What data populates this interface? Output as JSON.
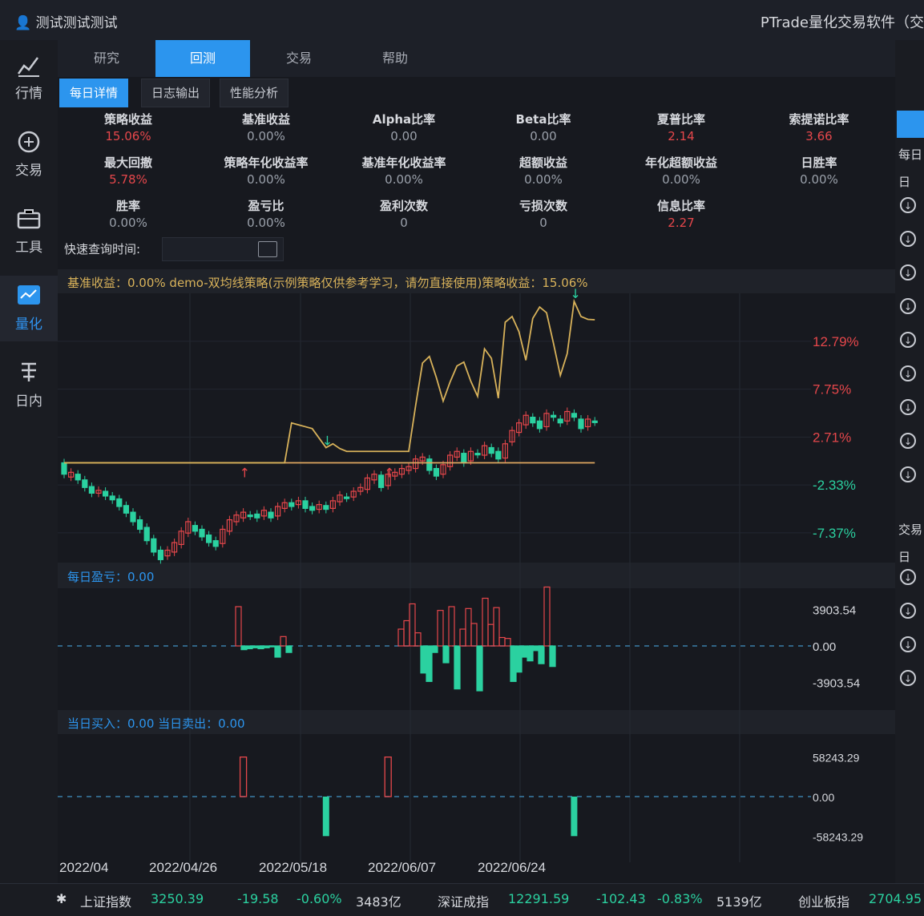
{
  "titlebar": {
    "user": "测试测试测试",
    "app": "PTrade量化交易软件（交"
  },
  "nav": [
    {
      "label": "行情",
      "icon": "chart-icon"
    },
    {
      "label": "交易",
      "icon": "trade-icon"
    },
    {
      "label": "工具",
      "icon": "toolbox-icon"
    },
    {
      "label": "量化",
      "icon": "quant-icon"
    },
    {
      "label": "日内",
      "icon": "intraday-icon"
    }
  ],
  "tabs": [
    "研究",
    "回测",
    "交易",
    "帮助"
  ],
  "subtabs": [
    "每日详情",
    "日志输出",
    "性能分析"
  ],
  "metrics": [
    {
      "label": "策略收益",
      "value": "15.06%",
      "color": "red"
    },
    {
      "label": "基准收益",
      "value": "0.00%",
      "color": ""
    },
    {
      "label": "Alpha比率",
      "value": "0.00",
      "color": ""
    },
    {
      "label": "Beta比率",
      "value": "0.00",
      "color": ""
    },
    {
      "label": "夏普比率",
      "value": "2.14",
      "color": "red"
    },
    {
      "label": "索提诺比率",
      "value": "3.66",
      "color": "red"
    },
    {
      "label": "最大回撤",
      "value": "5.78%",
      "color": "red"
    },
    {
      "label": "策略年化收益率",
      "value": "0.00%",
      "color": ""
    },
    {
      "label": "基准年化收益率",
      "value": "0.00%",
      "color": ""
    },
    {
      "label": "超额收益",
      "value": "0.00%",
      "color": ""
    },
    {
      "label": "年化超额收益",
      "value": "0.00%",
      "color": ""
    },
    {
      "label": "日胜率",
      "value": "0.00%",
      "color": ""
    },
    {
      "label": "胜率",
      "value": "0.00%",
      "color": ""
    },
    {
      "label": "盈亏比",
      "value": "0.00%",
      "color": ""
    },
    {
      "label": "盈利次数",
      "value": "0",
      "color": ""
    },
    {
      "label": "亏损次数",
      "value": "0",
      "color": ""
    },
    {
      "label": "信息比率",
      "value": "2.27",
      "color": "red"
    }
  ],
  "quick_query": {
    "label": "快速查询时间:"
  },
  "legends": {
    "main": "基准收益：0.00% demo-双均线策略(示例策略仅供参考学习，请勿直接使用)策略收益：15.06%",
    "daily_pnl": "每日盈亏：0.00",
    "trades": "当日买入：0.00  当日卖出：0.00"
  },
  "right_panel": {
    "labels": [
      "每日",
      "日",
      "交易",
      "日"
    ]
  },
  "status": {
    "sh_name": "上证指数",
    "sh_price": "3250.39",
    "sh_chg": "-19.58",
    "sh_pct": "-0.60%",
    "sh_vol": "3483亿",
    "sz_name": "深证成指",
    "sz_price": "12291.59",
    "sz_chg": "-102.43",
    "sz_pct": "-0.83%",
    "sz_vol": "5139亿",
    "cy_name": "创业板指",
    "cy_price": "2704.95"
  },
  "colors": {
    "up": "#e6474b",
    "down": "#2bd1a0",
    "strategy": "#d8b25a",
    "accent": "#2c95ee"
  },
  "chart_data": [
    {
      "type": "line",
      "title": "",
      "x_ticks": [
        "2022/04",
        "2022/04/26",
        "2022/05/18",
        "2022/06/07",
        "2022/06/24"
      ],
      "y_ticks": [
        "12.79%",
        "7.75%",
        "2.71%",
        "-2.33%",
        "-7.37%"
      ],
      "ylim": [
        -10,
        17
      ],
      "series": [
        {
          "name": "基准收益",
          "values": [
            0.0,
            0.0,
            0.0,
            0.0,
            0.0,
            0.0,
            0.0,
            0.0,
            0.0,
            0.0,
            0.0,
            0.0,
            0.0,
            0.0,
            0.0,
            0.0,
            0.0,
            0.0,
            0.0,
            0.0,
            0.0,
            0.0,
            0.0,
            0.0,
            0.0,
            0.0,
            0.0,
            0.0,
            0.0,
            0.0,
            0.0,
            0.0,
            0.0,
            0.0,
            0.0,
            0.0,
            0.0,
            0.0,
            0.0,
            0.0,
            0.0,
            0.0,
            0.0,
            0.0,
            0.0,
            0.0,
            0.0,
            0.0,
            0.0,
            0.0,
            0.0,
            0.0,
            0.0,
            0.0,
            0.0,
            0.0,
            0.0,
            0.0,
            0.0,
            0.0,
            0.0,
            0.0,
            0.0,
            0.0,
            0.0,
            0.0,
            0.0,
            0.0,
            0.0,
            0.0,
            0.0,
            0.0,
            0.0,
            0.0,
            0.0,
            0.0,
            0.0,
            0.0
          ]
        },
        {
          "name": "策略收益",
          "values": [
            0.0,
            0.0,
            0.0,
            0.0,
            0.0,
            0.0,
            0.0,
            0.0,
            0.0,
            0.0,
            0.0,
            0.0,
            0.0,
            0.0,
            0.0,
            0.0,
            0.0,
            0.0,
            0.0,
            0.0,
            0.0,
            0.0,
            0.0,
            0.0,
            0.0,
            0.0,
            0.0,
            0.0,
            0.0,
            0.0,
            0.0,
            0.0,
            0.0,
            4.2,
            4.0,
            3.8,
            3.6,
            2.6,
            1.6,
            2.0,
            1.5,
            1.2,
            1.2,
            1.2,
            1.2,
            1.2,
            1.2,
            1.2,
            1.2,
            1.2,
            1.2,
            6.0,
            10.5,
            11.2,
            9.0,
            6.5,
            8.5,
            10.2,
            10.6,
            8.6,
            7.0,
            12.0,
            11.0,
            6.8,
            14.8,
            15.4,
            13.8,
            10.8,
            15.2,
            16.4,
            15.8,
            12.6,
            9.2,
            11.5,
            17.0,
            15.4,
            15.1,
            15.06
          ]
        }
      ],
      "candles": {
        "open": [
          0,
          -1.5,
          -1.2,
          -1.8,
          -2.5,
          -3.2,
          -3.0,
          -3.5,
          -3.8,
          -4.5,
          -5.2,
          -6.0,
          -6.8,
          -8.0,
          -9.2,
          -9.8,
          -9.4,
          -8.6,
          -7.4,
          -6.6,
          -7.0,
          -7.6,
          -8.2,
          -8.5,
          -7.2,
          -6.2,
          -5.8,
          -5.5,
          -5.4,
          -5.6,
          -5.2,
          -5.6,
          -4.8,
          -4.2,
          -4.4,
          -4.0,
          -4.6,
          -4.9,
          -4.5,
          -4.8,
          -4.1,
          -3.6,
          -3.6,
          -3.0,
          -2.8,
          -1.8,
          -1.3,
          -2.4,
          -1.4,
          -1.2,
          -0.8,
          -0.6,
          0.2,
          0.4,
          -0.6,
          -1.2,
          -0.4,
          0.6,
          1.0,
          0.2,
          1.0,
          0.8,
          1.6,
          1.2,
          0.5,
          2.2,
          3.2,
          4.0,
          4.8,
          4.4,
          3.8,
          5.0,
          4.6,
          4.4,
          5.2,
          4.6,
          3.8,
          4.4
        ],
        "close": [
          -1.2,
          -1.0,
          -1.8,
          -2.6,
          -3.2,
          -2.9,
          -3.5,
          -3.9,
          -4.6,
          -5.3,
          -6.2,
          -7.0,
          -8.2,
          -9.4,
          -10.2,
          -9.2,
          -8.4,
          -7.2,
          -6.2,
          -7.2,
          -7.8,
          -8.4,
          -8.8,
          -7.0,
          -6.0,
          -5.5,
          -5.2,
          -5.6,
          -5.8,
          -5.0,
          -5.8,
          -4.6,
          -4.2,
          -4.6,
          -4.0,
          -4.8,
          -5.0,
          -4.4,
          -4.9,
          -4.0,
          -3.4,
          -3.7,
          -3.0,
          -2.6,
          -1.6,
          -1.2,
          -2.6,
          -1.2,
          -1.0,
          -0.6,
          -0.4,
          0.4,
          0.6,
          -0.8,
          -1.4,
          -0.2,
          0.8,
          1.2,
          0.0,
          1.2,
          0.9,
          1.8,
          1.0,
          0.4,
          2.0,
          3.4,
          4.2,
          5.0,
          4.2,
          3.6,
          5.2,
          4.8,
          4.2,
          5.4,
          4.8,
          3.6,
          4.6,
          4.3
        ]
      }
    },
    {
      "type": "bar",
      "title": "每日盈亏",
      "y_ticks": [
        "3903.54",
        "0.00",
        "-3903.54"
      ],
      "ylim": [
        -6000,
        6000
      ],
      "values": [
        0,
        0,
        0,
        0,
        0,
        0,
        0,
        0,
        0,
        0,
        0,
        0,
        0,
        0,
        0,
        0,
        0,
        0,
        0,
        0,
        0,
        0,
        0,
        0,
        0,
        0,
        0,
        0,
        0,
        0,
        0,
        4200,
        -400,
        -300,
        -200,
        -300,
        -200,
        -100,
        -1200,
        1000,
        -700,
        0,
        0,
        0,
        0,
        0,
        0,
        0,
        0,
        0,
        0,
        0,
        0,
        0,
        0,
        0,
        0,
        0,
        0,
        0,
        1800,
        2700,
        4500,
        1400,
        -2900,
        -3800,
        -700,
        3800,
        -1800,
        4200,
        -4600,
        1800,
        4000,
        2400,
        -4800,
        5100,
        2300,
        4100,
        900,
        800,
        -3800,
        -2800,
        -1200,
        -1600,
        -500,
        -1900,
        6300,
        -2200
      ]
    },
    {
      "type": "bar",
      "title": "当日买入/卖出",
      "y_ticks": [
        "58243.29",
        "0.00",
        "-58243.29"
      ],
      "ylim": [
        -85000,
        85000
      ],
      "series": [
        {
          "name": "当日买入",
          "values": [
            58243.29,
            58243.29
          ]
        },
        {
          "name": "当日卖出",
          "values": [
            -58243.29,
            -58243.29
          ]
        }
      ]
    }
  ]
}
